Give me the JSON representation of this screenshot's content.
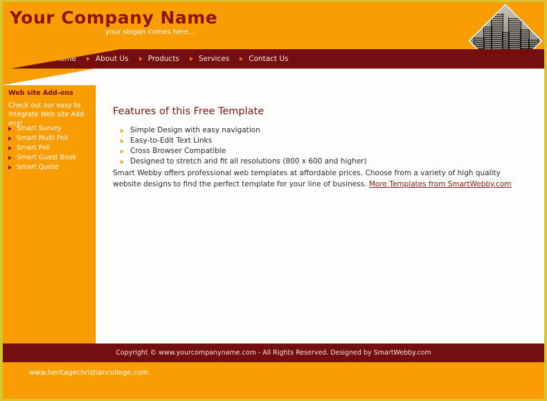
{
  "header": {
    "company_name": "Your Company Name",
    "slogan": "your slogan comes here...",
    "logo_image_name": "skyscraper-photo",
    "bg_color": "#f99d04",
    "title_color": "#8d1414"
  },
  "nav": {
    "bg_color": "#750f0f",
    "arrow_color": "#e8751a",
    "items": [
      {
        "label": "Home"
      },
      {
        "label": "About Us"
      },
      {
        "label": "Products"
      },
      {
        "label": "Services"
      },
      {
        "label": "Contact Us"
      }
    ]
  },
  "sidebar": {
    "bg_color": "#f99d04",
    "title": "Web site Add-ons",
    "description": "Check out our easy to integrate Web site Add-ons!",
    "links": [
      {
        "label": "Smart Survey"
      },
      {
        "label": "Smart Multi Poll"
      },
      {
        "label": "Smart Poll"
      },
      {
        "label": "Smart Guest Book"
      },
      {
        "label": "Smart Quote"
      }
    ]
  },
  "main": {
    "heading": "Features of this Free Template",
    "features": [
      {
        "label": "Simple Design with easy navigation"
      },
      {
        "label": "Easy-to-Edit Text Links"
      },
      {
        "label": "Cross Browser Compatible"
      },
      {
        "label": "Designed to stretch and fit all resolutions (800 x 600 and higher)"
      }
    ],
    "paragraph_text": "Smart Webby offers professional web templates at affordable prices. Choose from a variety of high quality website designs to find the perfect template for your line of business. ",
    "paragraph_link": "More Templates from SmartWebby.com"
  },
  "footer": {
    "copyright": "Copyright © www.yourcompanyname.com - All Rights Reserved. Designed by SmartWebby.com",
    "site_url": "www.heritagechristiancollege.com",
    "bar_color": "#750f0f",
    "bottom_color": "#f99d04"
  }
}
